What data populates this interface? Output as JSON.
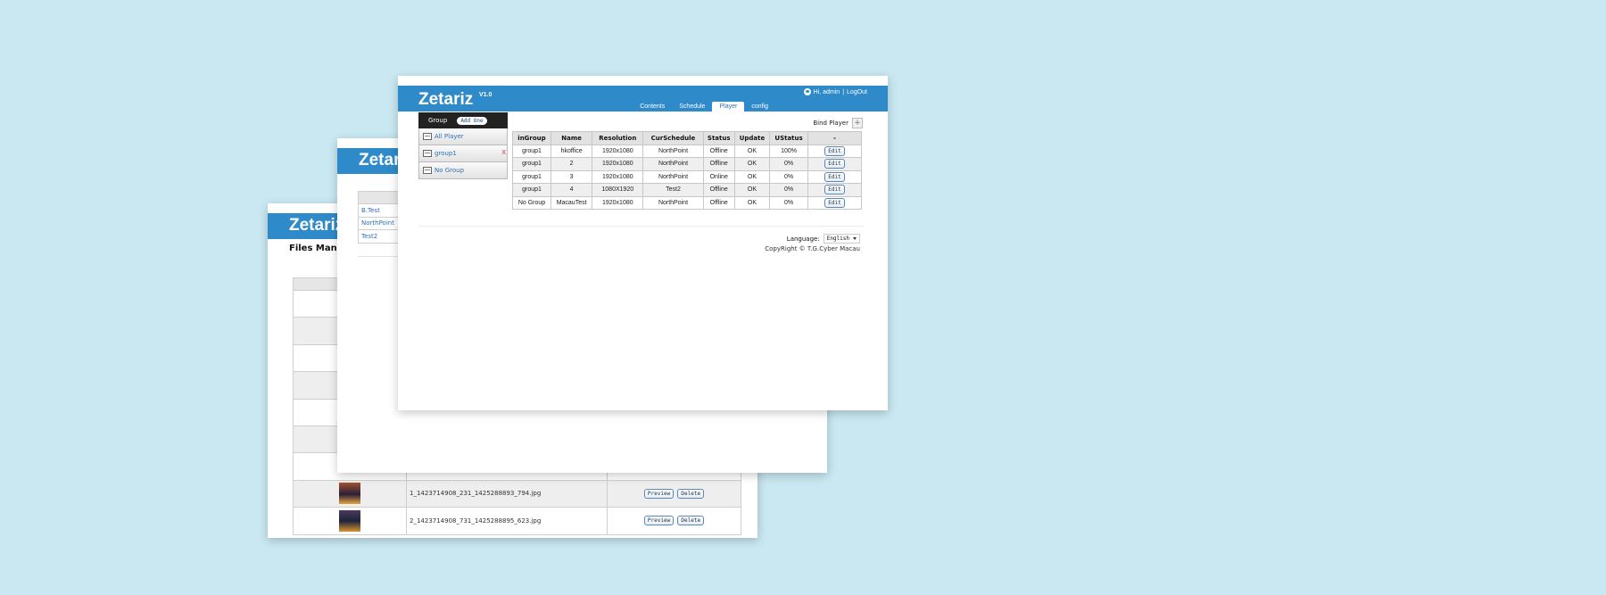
{
  "back_window": {
    "brand": "Zetariz",
    "title": "Files Manag",
    "rows": [
      {
        "file": "1_1423714908_231_1425288893_794.jpg",
        "preview": "Preview",
        "delete": "Delete"
      },
      {
        "file": "2_1423714908_731_1425288895_623.jpg",
        "preview": "Preview",
        "delete": "Delete"
      }
    ]
  },
  "middle_window": {
    "brand": "Zetar",
    "schedules": [
      "B.Test",
      "NorthPoint",
      "Test2"
    ]
  },
  "front_window": {
    "brand": "Zetariz",
    "version": "V1.0",
    "user": {
      "greeting": "Hi, admin",
      "separator": "|",
      "logout": "LogOut"
    },
    "nav": [
      "Contents",
      "Schedule",
      "Player",
      "config"
    ],
    "active_nav": "Player",
    "sidebar": {
      "header": "Group",
      "add_button": "Add One",
      "items": [
        "All Player",
        "group1",
        "No Group"
      ],
      "delete_mark": "X"
    },
    "bind_player": {
      "label": "Bind Player",
      "button": "+"
    },
    "table": {
      "headers": [
        "inGroup",
        "Name",
        "Resolution",
        "CurSchedule",
        "Status",
        "Update",
        "UStatus",
        "-"
      ],
      "rows": [
        {
          "ingroup": "group1",
          "name": "hkoffice",
          "resolution": "1920x1080",
          "schedule": "NorthPoint",
          "status": "Offline",
          "update": "OK",
          "ustatus": "100%",
          "action": "Edit"
        },
        {
          "ingroup": "group1",
          "name": "2",
          "resolution": "1920x1080",
          "schedule": "NorthPoint",
          "status": "Offline",
          "update": "OK",
          "ustatus": "0%",
          "action": "Edit"
        },
        {
          "ingroup": "group1",
          "name": "3",
          "resolution": "1920x1080",
          "schedule": "NorthPoint",
          "status": "Online",
          "update": "OK",
          "ustatus": "0%",
          "action": "Edit"
        },
        {
          "ingroup": "group1",
          "name": "4",
          "resolution": "1080X1920",
          "schedule": "Test2",
          "status": "Offline",
          "update": "OK",
          "ustatus": "0%",
          "action": "Edit"
        },
        {
          "ingroup": "No Group",
          "name": "MacauTest",
          "resolution": "1920x1080",
          "schedule": "NorthPoint",
          "status": "Offline",
          "update": "OK",
          "ustatus": "0%",
          "action": "Edit"
        }
      ]
    },
    "language": {
      "label": "Language:",
      "value": "English"
    },
    "copyright": "CopyRight © T.G.Cyber Macau"
  },
  "colors": {
    "background": "#c9e8f2",
    "header_blue": "#2f8ac9",
    "offline": "#e02b2b",
    "online": "#1e9a2a",
    "link": "#2f6fb5"
  }
}
